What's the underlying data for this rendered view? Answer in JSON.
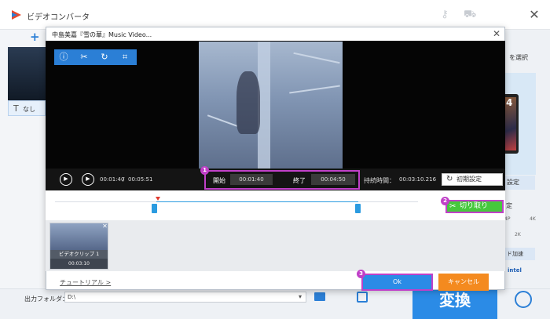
{
  "app": {
    "title": "ビデオコンバータ"
  },
  "left_panel": {
    "subtitle_none": "なし",
    "subtitle_icon": "text-icon"
  },
  "right_panel": {
    "select_label": "を選択",
    "device_number": "4",
    "settings_label": "設定",
    "settei_label": "定",
    "scale_left": "4P",
    "scale_right": "4K",
    "res_label": "2K",
    "hw_accel_label": "ド加速",
    "intel_label": "intel"
  },
  "dialog": {
    "title": "中島美嘉『雪の華』Music Video...",
    "tools": [
      "info-icon",
      "scissors-icon",
      "rotate-icon",
      "crop-icon"
    ],
    "player": {
      "current_time": "00:01:40",
      "separator": "/",
      "total_time": "00:05:51"
    },
    "trim": {
      "start_label": "開始",
      "start_value": "00:01:40",
      "end_label": "終了",
      "end_value": "00:04:50",
      "duration_label": "持続時間：",
      "duration_value": "00:03:10.216",
      "reset_label": "初期設定",
      "cut_label": "切り取り"
    },
    "clip": {
      "name": "ビデオクリップ 1",
      "duration": "00:03:10"
    },
    "tutorial_label": "チュートリアル >",
    "ok_label": "Ok",
    "cancel_label": "キャンセル",
    "badges": [
      "1",
      "2",
      "3"
    ]
  },
  "bottom_bar": {
    "output_label": "出力フォルダ：",
    "output_value": "D:\\",
    "convert_label": "変換"
  },
  "colors": {
    "accent_blue": "#2b8be6",
    "cut_green": "#46c83d",
    "cancel_orange": "#f48a1f",
    "highlight_purple": "#c040c8"
  }
}
